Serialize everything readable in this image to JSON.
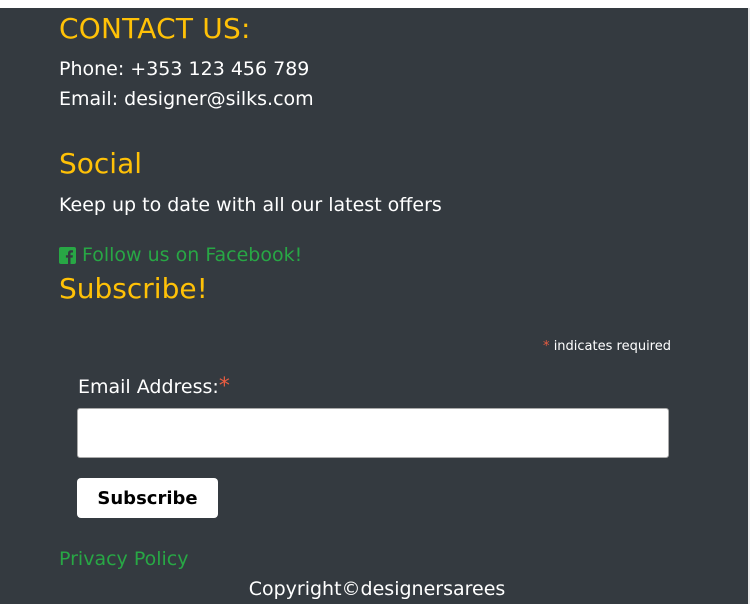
{
  "contact": {
    "heading": "CONTACT US:",
    "phone": "Phone: +353 123 456 789",
    "email": "Email: designer@silks.com"
  },
  "social": {
    "heading": "Social",
    "text": "Keep up to date with all our latest offers",
    "facebook_link": "Follow us on Facebook!",
    "facebook_icon": "facebook-square-icon"
  },
  "subscribe": {
    "heading": "Subscribe!",
    "required_asterisk": "*",
    "required_note": "indicates required",
    "email_label": "Email Address:",
    "email_value": "",
    "button_label": "Subscribe"
  },
  "footer": {
    "privacy_link": "Privacy Policy",
    "copyright": "Copyright©designersarees"
  },
  "colors": {
    "background": "#343a40",
    "heading": "#ffc107",
    "link": "#28a745",
    "required": "#e85c41"
  }
}
